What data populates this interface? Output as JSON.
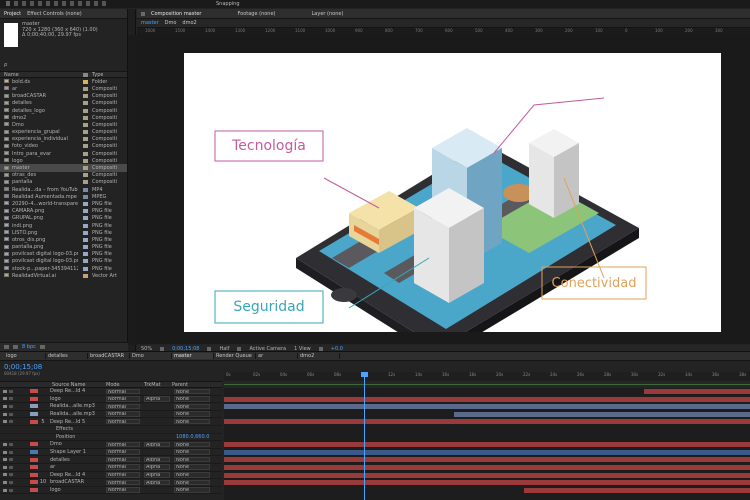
{
  "menu": {
    "snapping": "Snapping"
  },
  "project": {
    "tabs": [
      "Project",
      "Effect Controls (none)"
    ],
    "comp_name": "master",
    "comp_info1": "720 x 1280 (360 x 640) (1.00)",
    "comp_info2": "Δ 0;00;40;00, 29.97 fps",
    "search_placeholder": "ρ",
    "col_name": "Name",
    "col_type": "Type",
    "items": [
      {
        "name": "bold.ds",
        "type": "Folder",
        "color": "#d9b35a"
      },
      {
        "name": "ar",
        "type": "Compositi",
        "color": "#a6a28a"
      },
      {
        "name": "broadCASTAR",
        "type": "Compositi",
        "color": "#a6a28a"
      },
      {
        "name": "detalles",
        "type": "Compositi",
        "color": "#a6a28a"
      },
      {
        "name": "detalles_logo",
        "type": "Compositi",
        "color": "#a6a28a"
      },
      {
        "name": "dmo2",
        "type": "Compositi",
        "color": "#a6a28a"
      },
      {
        "name": "Dmo",
        "type": "Compositi",
        "color": "#a6a28a"
      },
      {
        "name": "experiencia_grupal",
        "type": "Compositi",
        "color": "#a6a28a"
      },
      {
        "name": "experiencia_individual",
        "type": "Compositi",
        "color": "#a6a28a"
      },
      {
        "name": "foto_video",
        "type": "Compositi",
        "color": "#a6a28a"
      },
      {
        "name": "Intro_para_evar",
        "type": "Compositi",
        "color": "#a6a28a"
      },
      {
        "name": "logo",
        "type": "Compositi",
        "color": "#a6a28a"
      },
      {
        "name": "master",
        "type": "Compositi",
        "color": "#a6a28a"
      },
      {
        "name": "otras_des",
        "type": "Compositi",
        "color": "#a6a28a"
      },
      {
        "name": "pantalla",
        "type": "Compositi",
        "color": "#a6a28a"
      },
      {
        "name": "Realida...da – from YouTube.mp4",
        "type": "MP4",
        "color": "#7a8ba8"
      },
      {
        "name": "Realidad Aumentada.mpe",
        "type": "MPEG",
        "color": "#7a8ba8"
      },
      {
        "name": "20290–4...world-transparent.png",
        "type": "PNG file",
        "color": "#9aa6c9"
      },
      {
        "name": "CAMARA.png",
        "type": "PNG file",
        "color": "#9aa6c9"
      },
      {
        "name": "GRUPAL.png",
        "type": "PNG file",
        "color": "#9aa6c9"
      },
      {
        "name": "indi.png",
        "type": "PNG file",
        "color": "#9aa6c9"
      },
      {
        "name": "LISTO.png",
        "type": "PNG file",
        "color": "#9aa6c9"
      },
      {
        "name": "otros_dis.png",
        "type": "PNG file",
        "color": "#9aa6c9"
      },
      {
        "name": "pantalla.png",
        "type": "PNG file",
        "color": "#9aa6c9"
      },
      {
        "name": "povilcast digital logo-03.png",
        "type": "PNG file",
        "color": "#9aa6c9"
      },
      {
        "name": "povilcast digital logo-03.png",
        "type": "PNG file",
        "color": "#9aa6c9"
      },
      {
        "name": "stock-p...paper-345394112.png",
        "type": "PNG file",
        "color": "#9aa6c9"
      },
      {
        "name": "RealidadVirtual.ai",
        "type": "Vector Art",
        "color": "#c9a46a"
      }
    ],
    "bpc": "8 bpc"
  },
  "comp_panel": {
    "tabs": [
      "Composition master",
      "Footage (none)",
      "Layer (none)"
    ],
    "subtabs": [
      "master",
      "Dmo",
      "dmo2"
    ],
    "ruler": [
      "1600",
      "1500",
      "1400",
      "1300",
      "1200",
      "1100",
      "1000",
      "900",
      "800",
      "700",
      "600",
      "500",
      "400",
      "300",
      "200",
      "100",
      "0",
      "100",
      "200",
      "300"
    ],
    "labels": {
      "tecnologia": "Tecnología",
      "seguridad": "Seguridad",
      "conectividad": "Conectividad"
    },
    "footer": {
      "zoom": "50%",
      "time": "0;00;15;08",
      "resolution": "Half",
      "camera": "Active Camera",
      "views": "1 View",
      "exposure": "+0.0"
    }
  },
  "timeline": {
    "tabs": [
      "logo",
      "detalles",
      "broadCASTAR",
      "Dmo",
      "master",
      "Render Queue",
      "ar",
      "dmo2"
    ],
    "active_tab": "master",
    "timecode": "0;00;15;08",
    "frames": "00418 (29.97 fps)",
    "cols": {
      "source": "Source Name",
      "mode": "Mode",
      "trkmat": "TrkMat",
      "parent": "Parent"
    },
    "ruler": [
      "0s",
      "02s",
      "04s",
      "06s",
      "08s",
      "10s",
      "12s",
      "14s",
      "16s",
      "18s",
      "20s",
      "22s",
      "24s",
      "26s",
      "28s",
      "30s",
      "32s",
      "34s",
      "36s",
      "38s"
    ],
    "layers": [
      {
        "num": "",
        "name": "Deep Re...ld 4",
        "mode": "Normal",
        "trk": "",
        "parent": "None",
        "color": "#c94a4a"
      },
      {
        "num": "",
        "name": "logo",
        "mode": "Normal",
        "trk": "Alpha",
        "parent": "None",
        "color": "#c94a4a"
      },
      {
        "num": "",
        "name": "Realida...alle.mp3",
        "mode": "Normal",
        "trk": "",
        "parent": "None",
        "color": "#8a9cc0"
      },
      {
        "num": "",
        "name": "Realida...alle.mp3",
        "mode": "Normal",
        "trk": "",
        "parent": "None",
        "color": "#8a9cc0"
      },
      {
        "num": "5",
        "name": "Deep Re...ld 5",
        "mode": "Normal",
        "trk": "",
        "parent": "None",
        "color": "#c94a4a"
      },
      {
        "num": "",
        "name": "Effects",
        "mode": "",
        "trk": "",
        "parent": "",
        "color": ""
      },
      {
        "num": "",
        "name": "Position",
        "mode": "",
        "trk": "",
        "parent": "1080.0,660.0",
        "color": ""
      },
      {
        "num": "",
        "name": "Dmo",
        "mode": "Normal",
        "trk": "Alpha",
        "parent": "None",
        "color": "#c94a4a"
      },
      {
        "num": "",
        "name": "Shape Layer 1",
        "mode": "Normal",
        "trk": "",
        "parent": "None",
        "color": "#4a7ab5"
      },
      {
        "num": "",
        "name": "detalles",
        "mode": "Normal",
        "trk": "Alpha",
        "parent": "None",
        "color": "#c94a4a"
      },
      {
        "num": "",
        "name": "ar",
        "mode": "Normal",
        "trk": "Alpha",
        "parent": "None",
        "color": "#c94a4a"
      },
      {
        "num": "",
        "name": "Deep Re...ld 4",
        "mode": "Normal",
        "trk": "Alpha",
        "parent": "None",
        "color": "#c94a4a"
      },
      {
        "num": "10",
        "name": "broadCASTAR",
        "mode": "Normal",
        "trk": "Alpha",
        "parent": "None",
        "color": "#c94a4a"
      },
      {
        "num": "",
        "name": "logo",
        "mode": "Normal",
        "trk": "",
        "parent": "None",
        "color": "#c94a4a"
      }
    ]
  },
  "colors": {
    "accent": "#4aa3ff",
    "tecnologia": "#c45aa0",
    "seguridad": "#3aa6b9",
    "conectividad": "#e0a25a"
  }
}
